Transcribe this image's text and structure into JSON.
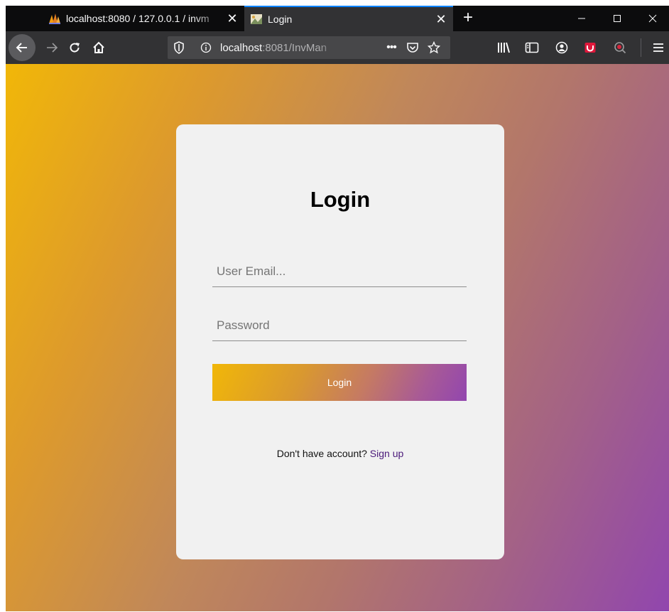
{
  "browser": {
    "tabs": [
      {
        "title": "localhost:8080 / 127.0.0.1 / invm",
        "icon": "phpmyadmin-icon",
        "active": false
      },
      {
        "title": "Login",
        "icon": "page-favicon-icon",
        "active": true
      }
    ],
    "new_tab_label": "+",
    "url_host": "localhost",
    "url_rest": ":8081/InvMan",
    "url_menu": "•••",
    "accent_color": "#0a84ff"
  },
  "page": {
    "background_gradient": [
      "#f1b708",
      "#9146ae"
    ],
    "card": {
      "title": "Login",
      "email_placeholder": "User Email...",
      "password_placeholder": "Password",
      "login_button_label": "Login",
      "signup_prompt": "Don't have account?",
      "signup_link": "Sign up",
      "link_color": "#4b1a7a"
    }
  }
}
